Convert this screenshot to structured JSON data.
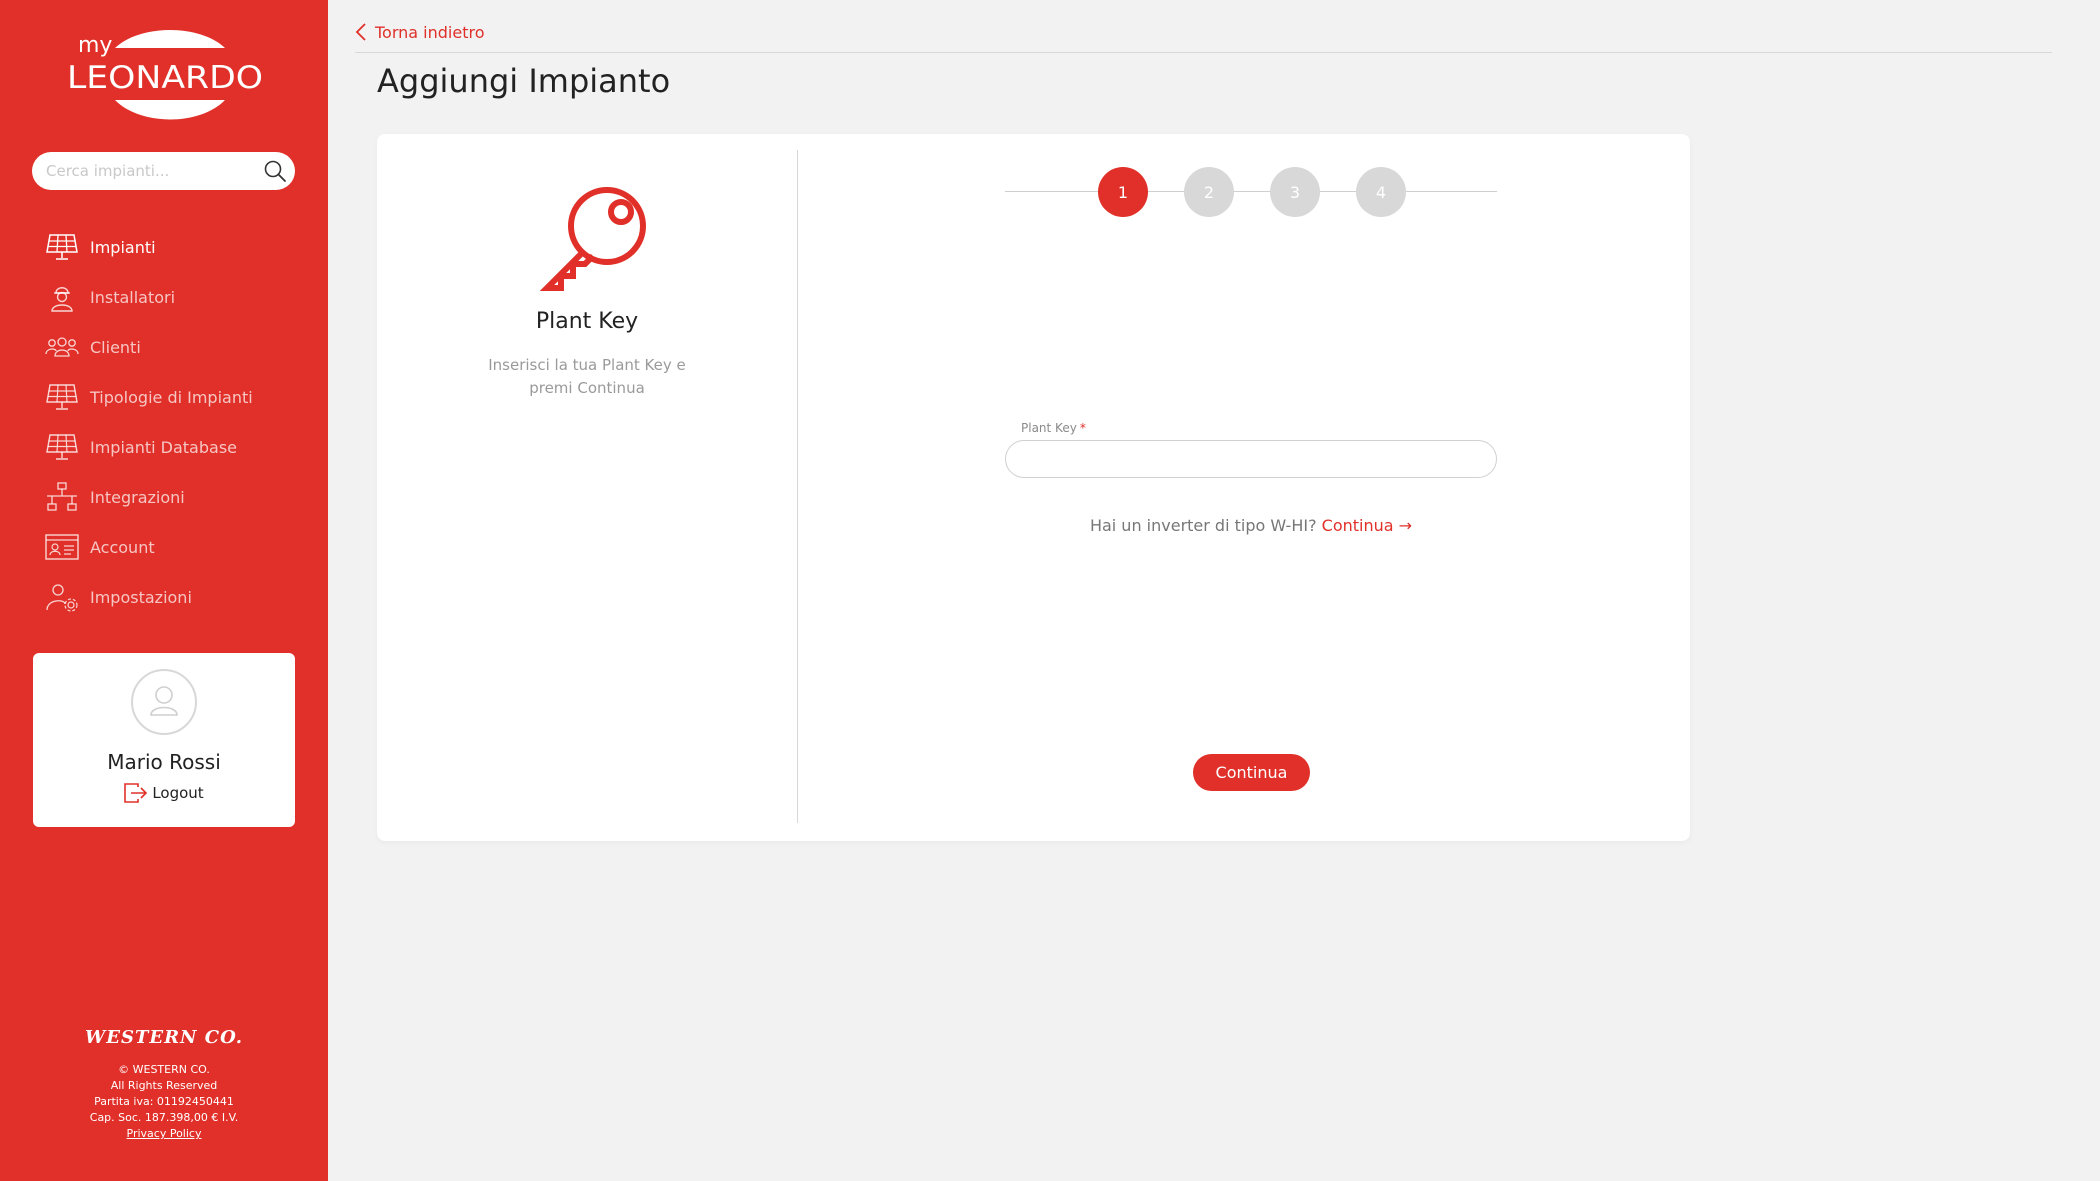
{
  "brand": {
    "logo_top": "my",
    "logo_main": "LEONARDO",
    "accent_color": "#e03029"
  },
  "search": {
    "placeholder": "Cerca impianti..."
  },
  "sidebar": {
    "items": [
      {
        "label": "Impianti",
        "icon": "solar-panel-icon",
        "active": true
      },
      {
        "label": "Installatori",
        "icon": "installer-helmet-icon",
        "active": false
      },
      {
        "label": "Clienti",
        "icon": "users-group-icon",
        "active": false
      },
      {
        "label": "Tipologie di Impianti",
        "icon": "solar-panel-icon",
        "active": false
      },
      {
        "label": "Impianti Database",
        "icon": "solar-panel-icon",
        "active": false
      },
      {
        "label": "Integrazioni",
        "icon": "network-hierarchy-icon",
        "active": false
      },
      {
        "label": "Account",
        "icon": "id-card-icon",
        "active": false
      },
      {
        "label": "Impostazioni",
        "icon": "user-settings-icon",
        "active": false
      }
    ]
  },
  "user": {
    "name": "Mario Rossi",
    "logout_label": "Logout"
  },
  "footer": {
    "company_logo": "WESTERN CO.",
    "lines": [
      "© WESTERN CO.",
      "All Rights Reserved",
      "Partita iva: 01192450441",
      "Cap. Soc. 187.398,00 € I.V."
    ],
    "privacy_label": "Privacy Policy"
  },
  "header": {
    "back_label": "Torna indietro",
    "title": "Aggiungi Impianto"
  },
  "step_panel": {
    "title": "Plant Key",
    "description": "Inserisci la tua Plant Key e premi Continua",
    "icon": "key-icon"
  },
  "stepper": {
    "steps": [
      "1",
      "2",
      "3",
      "4"
    ],
    "current": 1
  },
  "form": {
    "plant_key_label": "Plant Key",
    "required_marker": "*",
    "plant_key_value": "",
    "whi_text": "Hai un inverter di tipo W-HI?",
    "whi_link": "Continua →",
    "continue_label": "Continua"
  }
}
